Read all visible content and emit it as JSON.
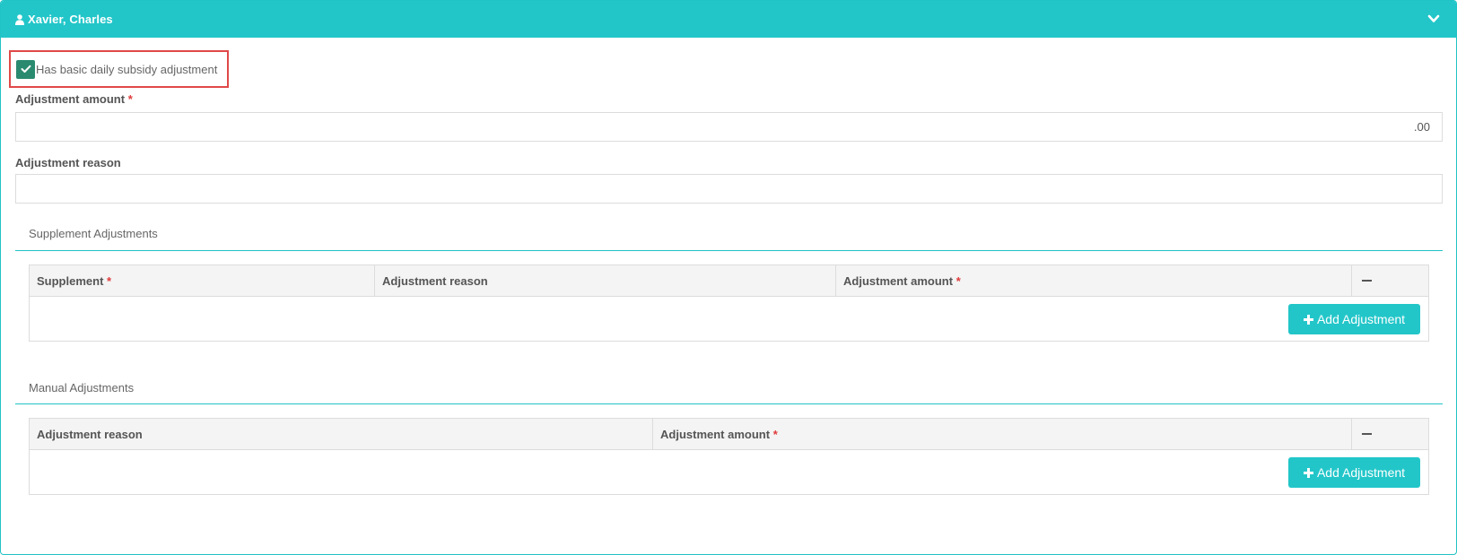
{
  "panel": {
    "title": "Xavier, Charles",
    "accent_color": "#22c6c9",
    "header_icon": "user-icon",
    "toggle_icon": "chevron-down-icon"
  },
  "subsidy": {
    "checkbox_label": "Has basic daily subsidy adjustment",
    "checked": true
  },
  "adjustment_amount": {
    "label": "Adjustment amount",
    "required_marker": "*",
    "value": ".00"
  },
  "adjustment_reason": {
    "label": "Adjustment reason",
    "value": ""
  },
  "supplement_adjustments": {
    "title": "Supplement Adjustments",
    "columns": {
      "supplement": "Supplement",
      "reason": "Adjustment reason",
      "amount": "Adjustment amount",
      "required_marker": "*"
    },
    "add_button_label": "Add Adjustment"
  },
  "manual_adjustments": {
    "title": "Manual Adjustments",
    "columns": {
      "reason": "Adjustment reason",
      "amount": "Adjustment amount",
      "required_marker": "*"
    },
    "add_button_label": "Add Adjustment"
  }
}
